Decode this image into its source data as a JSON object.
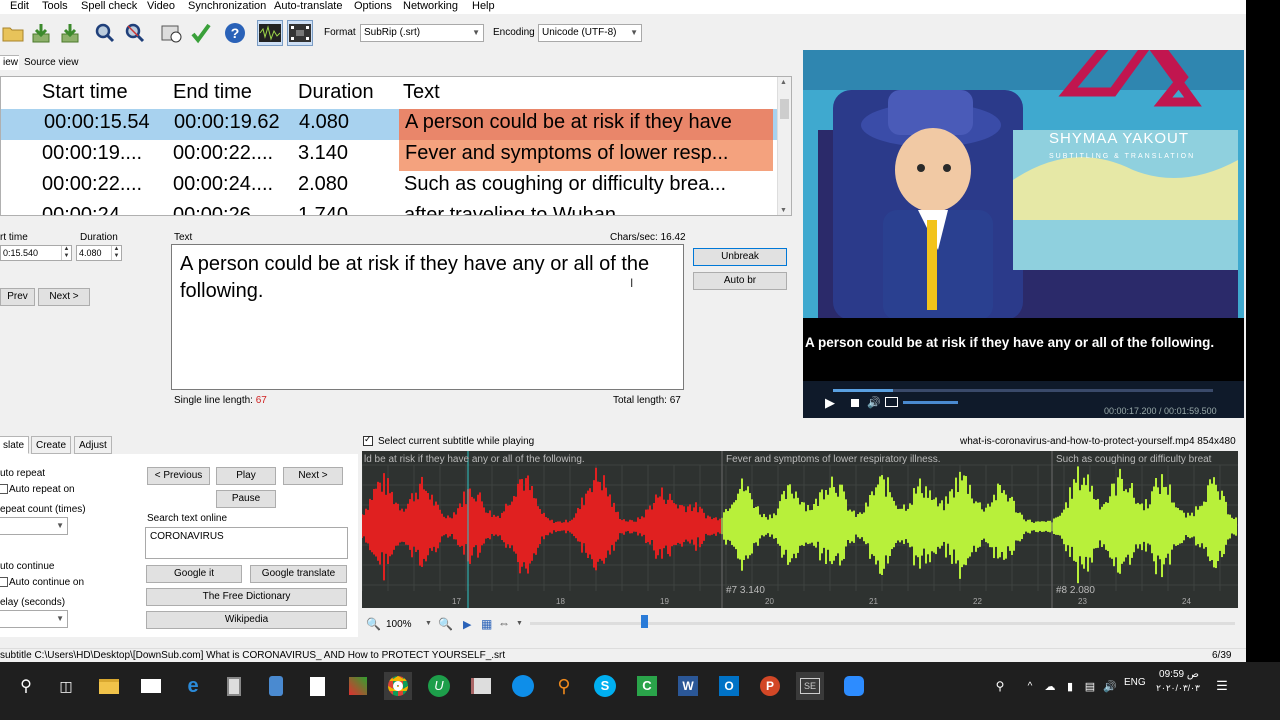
{
  "menu": [
    "Edit",
    "Tools",
    "Spell check",
    "Video",
    "Synchronization",
    "Auto-translate",
    "Options",
    "Networking",
    "Help"
  ],
  "toolbar": {
    "format_label": "Format",
    "format_value": "SubRip (.srt)",
    "encoding_label": "Encoding",
    "encoding_value": "Unicode (UTF-8)"
  },
  "view_tabs": {
    "list_view": "iew",
    "source_view": "Source view"
  },
  "grid": {
    "headers": {
      "start": "Start time",
      "end": "End time",
      "duration": "Duration",
      "text": "Text"
    },
    "rows": [
      {
        "start": "00:00:15.54",
        "end": "00:00:19.62",
        "duration": "4.080",
        "text": "A person could be at risk if they have"
      },
      {
        "start": "00:00:19....",
        "end": "00:00:22....",
        "duration": "3.140",
        "text": "Fever and symptoms of lower resp..."
      },
      {
        "start": "00:00:22....",
        "end": "00:00:24....",
        "duration": "2.080",
        "text": "Such as coughing or difficulty brea..."
      },
      {
        "start": "00:00:24....",
        "end": "00:00:26....",
        "duration": "1.740",
        "text": "after traveling to Wuhan"
      }
    ]
  },
  "editor": {
    "start_label": "rt time",
    "start_value": "0:15.540",
    "duration_label": "Duration",
    "duration_value": "4.080",
    "text_label": "Text",
    "chars_sec": "Chars/sec: 16.42",
    "text": "A person could be at risk if they have any or all of the following.",
    "prev": "Prev",
    "next": "Next >",
    "unbreak": "Unbreak",
    "auto_br": "Auto br",
    "single_line_label": "Single line length:",
    "single_line_value": "67",
    "total_length": "Total length: 67"
  },
  "video": {
    "logo_name": "SHYMAA YAKOUT",
    "logo_tagline": "SUBTITLING & TRANSLATION",
    "subtitle": "A person could be at risk if they have any or all of the following.",
    "time": "00:00:17.200 / 00:01:59.500"
  },
  "bottom_tabs": [
    "slate",
    "Create",
    "Adjust"
  ],
  "translate": {
    "auto_repeat": "uto repeat",
    "auto_repeat_on": "Auto repeat on",
    "repeat_count": "epeat count (times)",
    "auto_continue": "uto continue",
    "auto_continue_on": "Auto continue on",
    "delay": "elay (seconds)",
    "previous": "< Previous",
    "play": "Play",
    "next": "Next >",
    "pause": "Pause",
    "search_label": "Search text online",
    "search_value": "CORONAVIRUS",
    "google_it": "Google it",
    "google_translate": "Google translate",
    "free_dictionary": "The Free Dictionary",
    "wikipedia": "Wikipedia"
  },
  "waveform": {
    "select_label": "Select current subtitle while playing",
    "file": "what-is-coronavirus-and-how-to-protect-yourself.mp4 854x480",
    "text1": "ld be at risk if they have any or all of the following.",
    "text2": "Fever and symptoms of lower respiratory illness.",
    "text3": "Such as coughing or difficulty breat",
    "label7": "#7  3.140",
    "label8": "#8  2.080",
    "ticks": [
      "17",
      "18",
      "19",
      "20",
      "21",
      "22",
      "23",
      "24"
    ],
    "zoom": "100%"
  },
  "status": {
    "path": "subtitle C:\\Users\\HD\\Desktop\\[DownSub.com] What is CORONAVIRUS_ AND How to PROTECT YOURSELF_.srt",
    "count": "6/39"
  },
  "taskbar": {
    "lang": "ENG",
    "time": "09:59 ص",
    "date": "٢٠٢٠/٠٣/٠٣"
  }
}
